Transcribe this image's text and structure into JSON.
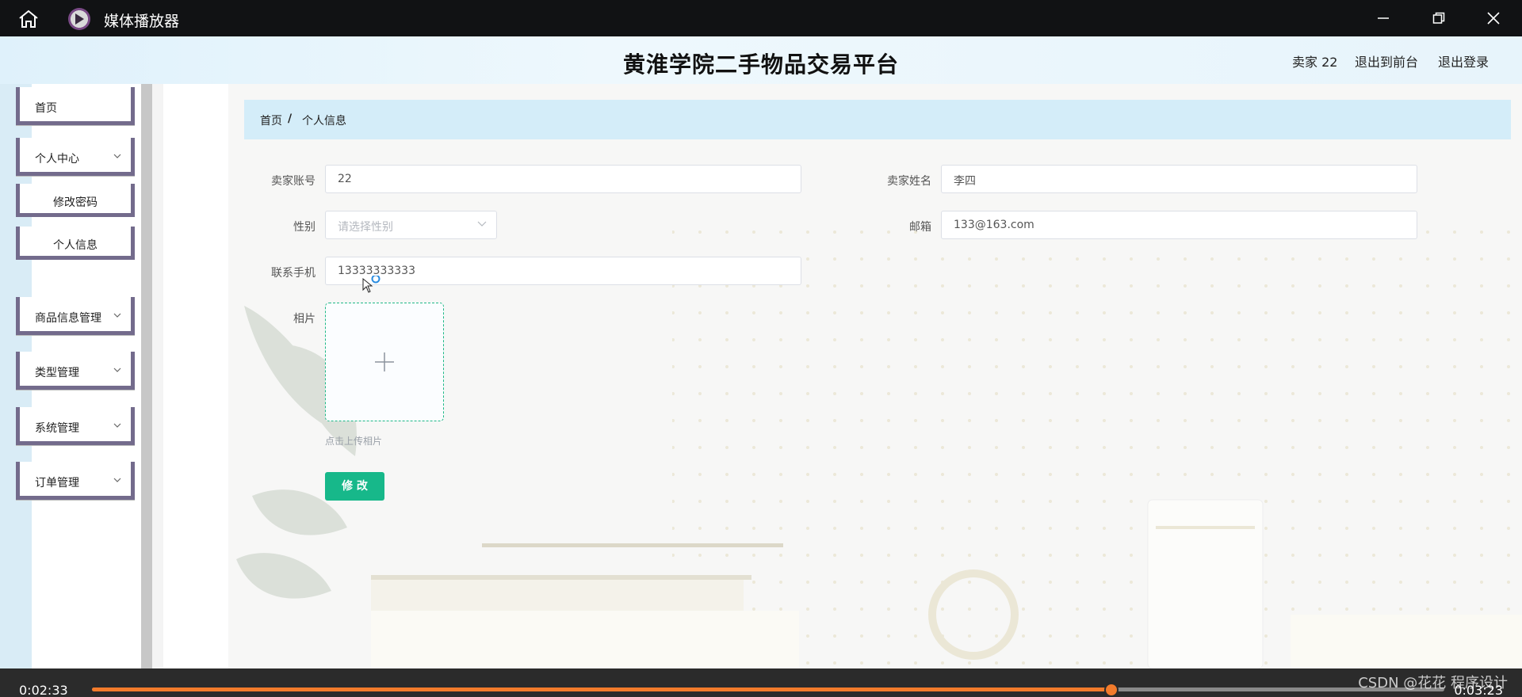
{
  "player": {
    "app_title": "媒体播放器",
    "current_time": "0:02:33",
    "total_time": "0:03:23",
    "progress_fraction": 0.754,
    "watermark": "CSDN @花花 程序设计",
    "accent_color": "#f37b2b"
  },
  "header": {
    "site_title": "黄淮学院二手物品交易平台",
    "user_label": "卖家 22",
    "front_link": "退出到前台",
    "logout_link": "退出登录"
  },
  "sidebar": {
    "items": [
      {
        "label": "首页"
      },
      {
        "label": "个人中心"
      },
      {
        "label": "修改密码"
      },
      {
        "label": "个人信息"
      },
      {
        "label": "商品信息管理"
      },
      {
        "label": "类型管理"
      },
      {
        "label": "系统管理"
      },
      {
        "label": "订单管理"
      }
    ]
  },
  "breadcrumb": {
    "home": "首页",
    "separator": "/",
    "current": "个人信息"
  },
  "form": {
    "account_label": "卖家账号",
    "account_value": "22",
    "name_label": "卖家姓名",
    "name_value": "李四",
    "gender_label": "性别",
    "gender_placeholder": "请选择性别",
    "email_label": "邮箱",
    "email_value": "133@163.com",
    "phone_label": "联系手机",
    "phone_value": "13333333333",
    "photo_label": "相片",
    "upload_tip": "点击上传相片",
    "submit_label": "修 改",
    "submit_color": "#17b88a"
  }
}
